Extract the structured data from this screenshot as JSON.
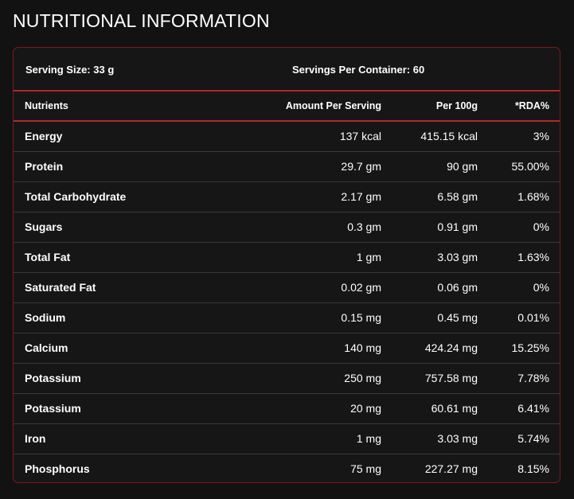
{
  "page_title": "NUTRITIONAL INFORMATION",
  "serving": {
    "size": "Serving Size: 33 g",
    "per_container": "Servings Per Container: 60"
  },
  "columns": {
    "nutrients": "Nutrients",
    "amount_per_serving": "Amount Per Serving",
    "per_100g": "Per 100g",
    "rda": "*RDA%"
  },
  "rows": [
    {
      "name": "Energy",
      "serving": "137 kcal",
      "per100": "415.15 kcal",
      "rda": "3%"
    },
    {
      "name": "Protein",
      "serving": "29.7 gm",
      "per100": "90 gm",
      "rda": "55.00%"
    },
    {
      "name": "Total Carbohydrate",
      "serving": "2.17 gm",
      "per100": "6.58 gm",
      "rda": "1.68%"
    },
    {
      "name": "Sugars",
      "serving": "0.3 gm",
      "per100": "0.91 gm",
      "rda": "0%"
    },
    {
      "name": "Total Fat",
      "serving": "1 gm",
      "per100": "3.03 gm",
      "rda": "1.63%"
    },
    {
      "name": "Saturated Fat",
      "serving": "0.02 gm",
      "per100": "0.06 gm",
      "rda": "0%"
    },
    {
      "name": "Sodium",
      "serving": "0.15 mg",
      "per100": "0.45 mg",
      "rda": "0.01%"
    },
    {
      "name": "Calcium",
      "serving": "140 mg",
      "per100": "424.24 mg",
      "rda": "15.25%"
    },
    {
      "name": "Potassium",
      "serving": "250 mg",
      "per100": "757.58 mg",
      "rda": "7.78%"
    },
    {
      "name": "Potassium",
      "serving": "20 mg",
      "per100": "60.61 mg",
      "rda": "6.41%"
    },
    {
      "name": "Iron",
      "serving": "1 mg",
      "per100": "3.03 mg",
      "rda": "5.74%"
    },
    {
      "name": "Phosphorus",
      "serving": "75 mg",
      "per100": "227.27 mg",
      "rda": "8.15%"
    }
  ],
  "colors": {
    "background": "#121212",
    "accent_border": "#b3282b",
    "text": "#ffffff"
  }
}
